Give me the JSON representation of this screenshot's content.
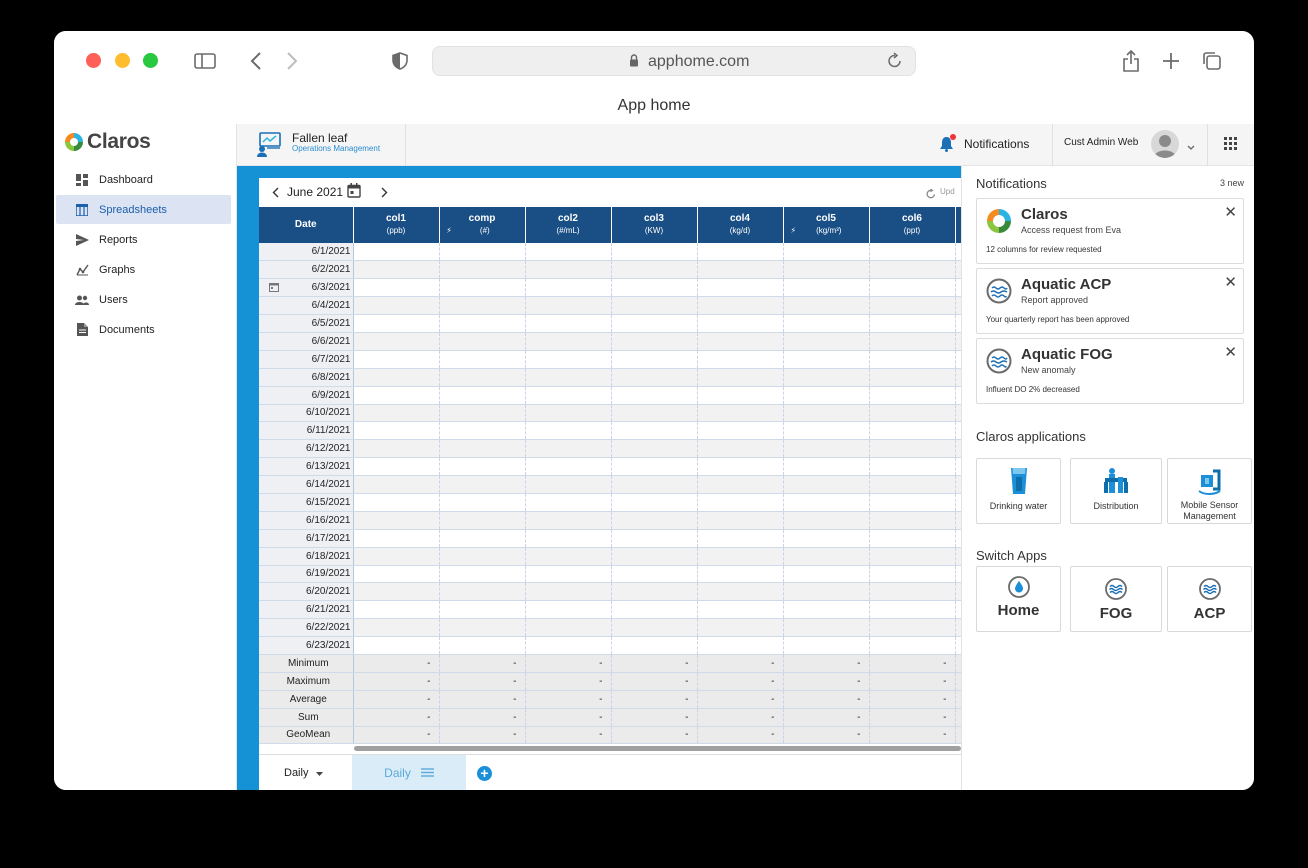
{
  "browser": {
    "url": "apphome.com",
    "page_title": "App home"
  },
  "sidebar": {
    "logo": "Claros",
    "items": [
      {
        "label": "Dashboard",
        "icon": "dashboard-icon"
      },
      {
        "label": "Spreadsheets",
        "icon": "spreadsheet-icon",
        "active": true
      },
      {
        "label": "Reports",
        "icon": "send-icon"
      },
      {
        "label": "Graphs",
        "icon": "graph-icon"
      },
      {
        "label": "Users",
        "icon": "users-icon"
      },
      {
        "label": "Documents",
        "icon": "document-icon"
      }
    ]
  },
  "header": {
    "site_name": "Fallen leaf",
    "site_sub": "Operations Management",
    "notifications_label": "Notifications",
    "user_name": "Cust Admin Web"
  },
  "sheet": {
    "month": "June 2021",
    "updated_label": "Upd",
    "date_header": "Date",
    "columns": [
      {
        "name": "col1",
        "unit": "(ppb)"
      },
      {
        "name": "comp",
        "unit": "(#)",
        "bolt": true
      },
      {
        "name": "col2",
        "unit": "(#/mL)"
      },
      {
        "name": "col3",
        "unit": "(KW)"
      },
      {
        "name": "col4",
        "unit": "(kg/d)"
      },
      {
        "name": "col5",
        "unit": "(kg/m³)",
        "bolt": true
      },
      {
        "name": "col6",
        "unit": "(ppt)"
      }
    ],
    "dates": [
      "6/1/2021",
      "6/2/2021",
      "6/3/2021",
      "6/4/2021",
      "6/5/2021",
      "6/6/2021",
      "6/7/2021",
      "6/8/2021",
      "6/9/2021",
      "6/10/2021",
      "6/11/2021",
      "6/12/2021",
      "6/13/2021",
      "6/14/2021",
      "6/15/2021",
      "6/16/2021",
      "6/17/2021",
      "6/18/2021",
      "6/19/2021",
      "6/20/2021",
      "6/21/2021",
      "6/22/2021",
      "6/23/2021"
    ],
    "stats": [
      "Minimum",
      "Maximum",
      "Average",
      "Sum",
      "GeoMean"
    ],
    "stat_value": "-",
    "tabs": {
      "period": "Daily",
      "active_tab": "Daily"
    }
  },
  "notifications": {
    "title": "Notifications",
    "count": "3 new",
    "items": [
      {
        "title": "Claros",
        "subtitle": "Access request from Eva",
        "body": "12 columns for review requested",
        "logo": "claros-logo"
      },
      {
        "title": "Aquatic ACP",
        "subtitle": "Report approved",
        "body": "Your quarterly report has been approved",
        "logo": "aquatic-logo"
      },
      {
        "title": "Aquatic FOG",
        "subtitle": "New anomaly",
        "body": "Influent DO 2% decreased",
        "logo": "aquatic-logo"
      }
    ]
  },
  "applications": {
    "title": "Claros applications",
    "items": [
      {
        "label": "Drinking water",
        "icon": "drinking-water-icon"
      },
      {
        "label": "Distribution",
        "icon": "distribution-icon"
      },
      {
        "label": "Mobile Sensor Management",
        "icon": "mobile-sensor-icon"
      }
    ]
  },
  "switch_apps": {
    "title": "Switch Apps",
    "items": [
      {
        "label": "Home",
        "icon": "home-drop-icon"
      },
      {
        "label": "FOG",
        "icon": "fog-wave-icon"
      },
      {
        "label": "ACP",
        "icon": "acp-wave-icon"
      }
    ]
  },
  "colors": {
    "header_blue": "#1a4f85",
    "accent_blue": "#1592d6",
    "active_nav": "#dce3f2"
  }
}
